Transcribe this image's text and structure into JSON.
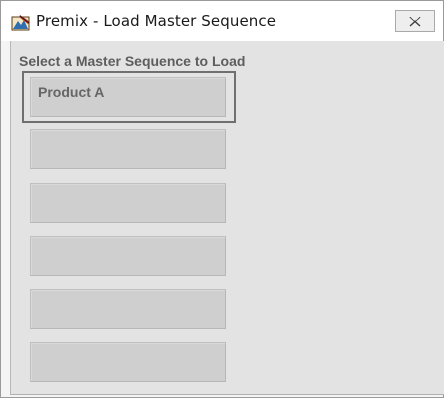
{
  "window": {
    "title": "Premix - Load Master Sequence"
  },
  "main": {
    "prompt": "Select a Master Sequence to Load",
    "sequences": [
      {
        "label": "Product A"
      },
      {
        "label": ""
      },
      {
        "label": ""
      },
      {
        "label": ""
      },
      {
        "label": ""
      },
      {
        "label": ""
      }
    ]
  }
}
